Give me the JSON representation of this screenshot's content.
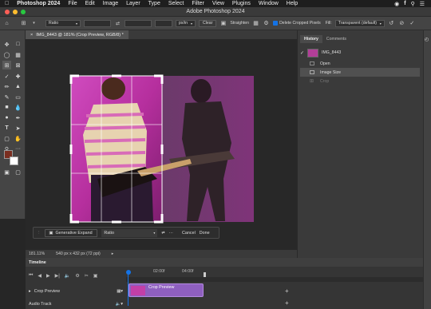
{
  "menubar": {
    "app_name": "Photoshop 2024",
    "items": [
      "File",
      "Edit",
      "Image",
      "Layer",
      "Type",
      "Select",
      "Filter",
      "View",
      "Plugins",
      "Window",
      "Help"
    ]
  },
  "titlebar": {
    "title": "Adobe Photoshop 2024"
  },
  "options": {
    "ratio": "Ratio",
    "unit": "px/in",
    "clear": "Clear",
    "straighten": "Straighten",
    "delete_cropped": "Delete Cropped Pixels",
    "fill_label": "Fill:",
    "fill_value": "Transparent (default)"
  },
  "document": {
    "tab_title": "IMG_8443 @ 181% (Crop Preview, RGB/8) *"
  },
  "status": {
    "zoom": "181.11%",
    "doc_size": "540 px x 432 px (72 ppi)"
  },
  "crop_bar": {
    "generative_expand": "Generative Expand",
    "ratio": "Ratio",
    "dots": "···",
    "cancel": "Cancel",
    "done": "Done"
  },
  "history": {
    "tabs": [
      "History",
      "Comments"
    ],
    "snapshot": "IMG_8443",
    "items": [
      {
        "label": "Open",
        "state": "normal"
      },
      {
        "label": "Image Size",
        "state": "selected"
      },
      {
        "label": "Crop",
        "state": "dim"
      }
    ]
  },
  "timeline": {
    "header": "Timeline",
    "ticks": [
      "02:00f",
      "04:00f"
    ],
    "track_name": "Crop Preview",
    "audio_track": "Audio Track",
    "clip_label": "Crop Preview"
  },
  "colors": {
    "accent": "#1473e6",
    "clip": "#8e5fbf",
    "image_magenta": "#c43bb0"
  }
}
